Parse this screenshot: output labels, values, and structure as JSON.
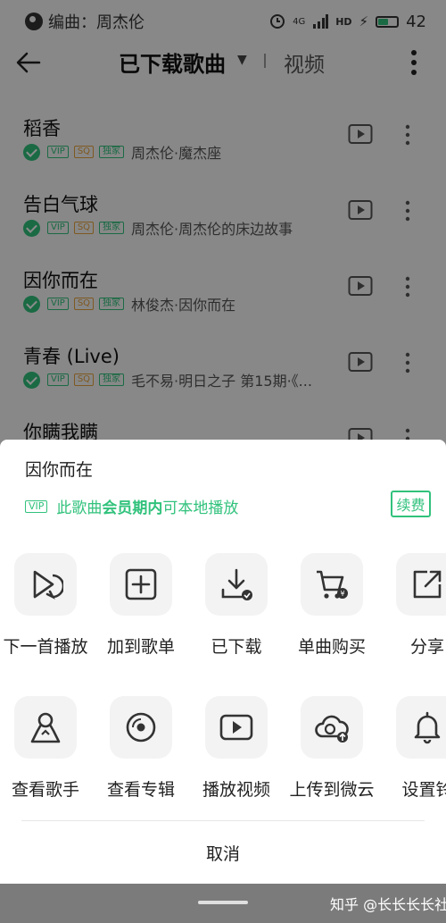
{
  "status_bar": {
    "left_text": "编曲：周杰伦",
    "battery": "42",
    "net_label": "4G",
    "hd_label": "HD"
  },
  "header": {
    "title": "已下载歌曲",
    "video_tab": "视频"
  },
  "songs": [
    {
      "title": "稻香",
      "badges": [
        "VIP",
        "SQ",
        "独家"
      ],
      "artist": "周杰伦·魔杰座"
    },
    {
      "title": "告白气球",
      "badges": [
        "VIP",
        "SQ",
        "独家"
      ],
      "artist": "周杰伦·周杰伦的床边故事"
    },
    {
      "title": "因你而在",
      "badges": [
        "VIP",
        "SQ",
        "独家"
      ],
      "artist": "林俊杰·因你而在"
    },
    {
      "title": "青春 (Live)",
      "badges": [
        "VIP",
        "SQ",
        "独家"
      ],
      "artist": "毛不易·明日之子 第15期·《..."
    },
    {
      "title": "你瞒我瞒"
    }
  ],
  "sheet": {
    "song_title": "因你而在",
    "vip_badge": "VIP",
    "vip_text_a": "此歌曲",
    "vip_text_b": "会员期内",
    "vip_text_c": "可本地播放",
    "renew_label": "续费",
    "actions_row1": [
      {
        "label": "下一首播放",
        "icon": "play-next-icon"
      },
      {
        "label": "加到歌单",
        "icon": "add-playlist-icon"
      },
      {
        "label": "已下载",
        "icon": "downloaded-icon"
      },
      {
        "label": "单曲购买",
        "icon": "cart-icon"
      },
      {
        "label": "分享",
        "icon": "share-icon"
      }
    ],
    "actions_row2": [
      {
        "label": "查看歌手",
        "icon": "singer-icon"
      },
      {
        "label": "查看专辑",
        "icon": "album-icon"
      },
      {
        "label": "播放视频",
        "icon": "video-icon"
      },
      {
        "label": "上传到微云",
        "icon": "cloud-upload-icon"
      },
      {
        "label": "设置铃",
        "icon": "bell-icon"
      }
    ],
    "cancel_label": "取消"
  },
  "watermark": "知乎 @长长长长社",
  "colors": {
    "accent": "#31c27c",
    "sq": "#e6a23c",
    "overlay": "rgba(0,0,0,0.45)",
    "nav_strip": "#7b7b7b"
  }
}
